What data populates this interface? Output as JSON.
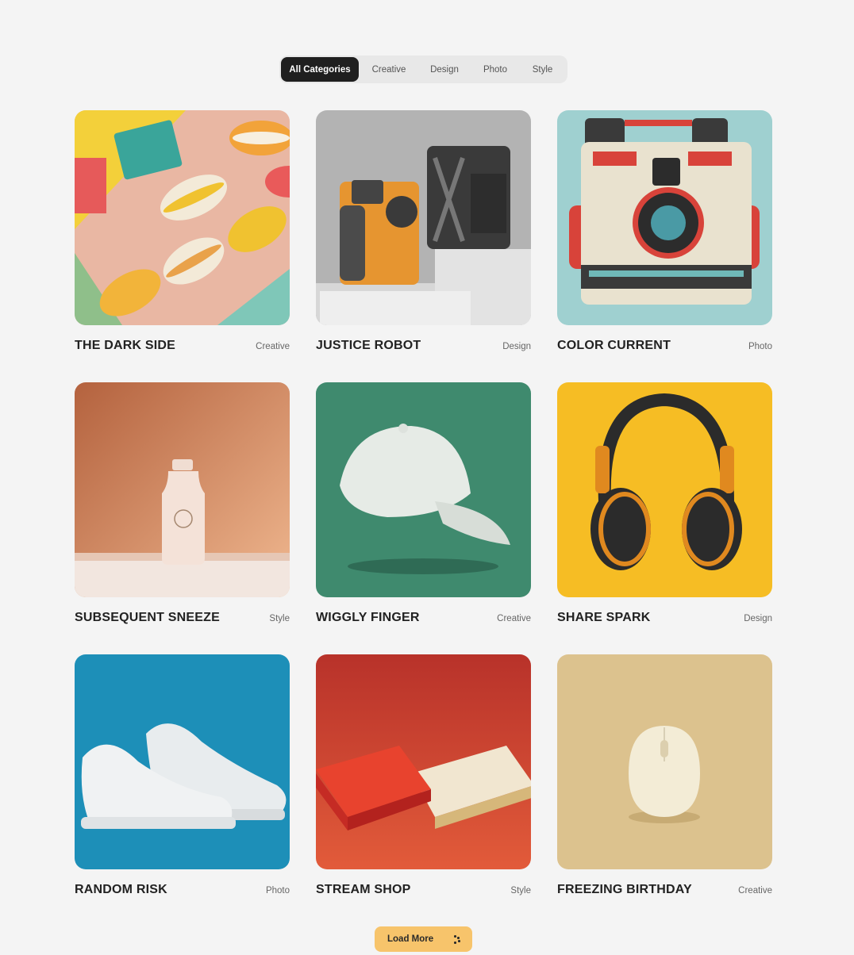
{
  "filters": {
    "items": [
      "All Categories",
      "Creative",
      "Design",
      "Photo",
      "Style"
    ],
    "active": "All Categories"
  },
  "cards": [
    {
      "title": "THE DARK SIDE",
      "category": "Creative",
      "image": "macarons-image"
    },
    {
      "title": "JUSTICE ROBOT",
      "category": "Design",
      "image": "robot-cameras-image"
    },
    {
      "title": "COLOR CURRENT",
      "category": "Photo",
      "image": "polaroid-camera-image"
    },
    {
      "title": "SUBSEQUENT SNEEZE",
      "category": "Style",
      "image": "bottle-image"
    },
    {
      "title": "WIGGLY FINGER",
      "category": "Creative",
      "image": "cap-image"
    },
    {
      "title": "SHARE SPARK",
      "category": "Design",
      "image": "headphones-image"
    },
    {
      "title": "RANDOM RISK",
      "category": "Photo",
      "image": "sneakers-image"
    },
    {
      "title": "STREAM SHOP",
      "category": "Style",
      "image": "business-cards-image"
    },
    {
      "title": "FREEZING BIRTHDAY",
      "category": "Creative",
      "image": "mouse-image"
    }
  ],
  "load_more": {
    "label": "Load More",
    "icon": "loading-dots-icon"
  },
  "colors": {
    "background": "#f4f4f4",
    "pill_active": "#1f1f1f",
    "pill_bar": "#e8e8e8",
    "load_more": "#f7c46b"
  }
}
